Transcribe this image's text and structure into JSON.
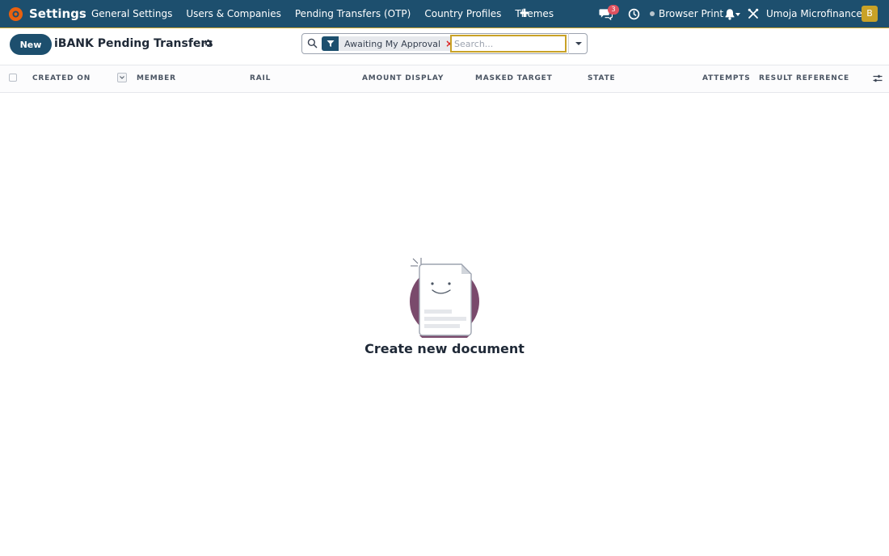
{
  "navbar": {
    "app_name": "Settings",
    "app_logo_icon": "app-logo-icon",
    "menu": [
      {
        "label": "General Settings"
      },
      {
        "label": "Users & Companies"
      },
      {
        "label": "Pending Transfers (OTP)"
      },
      {
        "label": "Country Profiles"
      },
      {
        "label": "Themes"
      }
    ],
    "add_icon": "plus-icon",
    "systray": {
      "messages_icon": "chat-icon",
      "messages_count": "3",
      "activity_icon": "clock-icon",
      "print_label": "Browser Print",
      "notifications_icon": "bell-icon",
      "debug_icon": "tools-icon",
      "company_name": "Umoja Microfinance",
      "user_initial": "B"
    },
    "colors": {
      "navbar_bg": "#1d4f6e",
      "accent": "#c9a227",
      "logo": "#e8610f",
      "badge": "#e05260"
    }
  },
  "control_panel": {
    "new_button_label": "New",
    "title": "iBANK Pending Transfers",
    "settings_icon": "gear-icon",
    "search": {
      "facet_icon": "filter-icon",
      "facet_label": "Awaiting My Approval",
      "facet_remove": "×",
      "placeholder": "Search...",
      "value": ""
    }
  },
  "list": {
    "columns": [
      {
        "label": "CREATED ON"
      },
      {
        "label": "MEMBER"
      },
      {
        "label": "RAIL"
      },
      {
        "label": "AMOUNT DISPLAY"
      },
      {
        "label": "MASKED TARGET"
      },
      {
        "label": "STATE"
      },
      {
        "label": "ATTEMPTS"
      },
      {
        "label": "RESULT REFERENCE"
      }
    ],
    "optional_columns_icon": "sliders-icon"
  },
  "empty_state": {
    "title": "Create new document",
    "illustration": "smiling-document-icon",
    "illustration_color": "#7a4a6c"
  }
}
